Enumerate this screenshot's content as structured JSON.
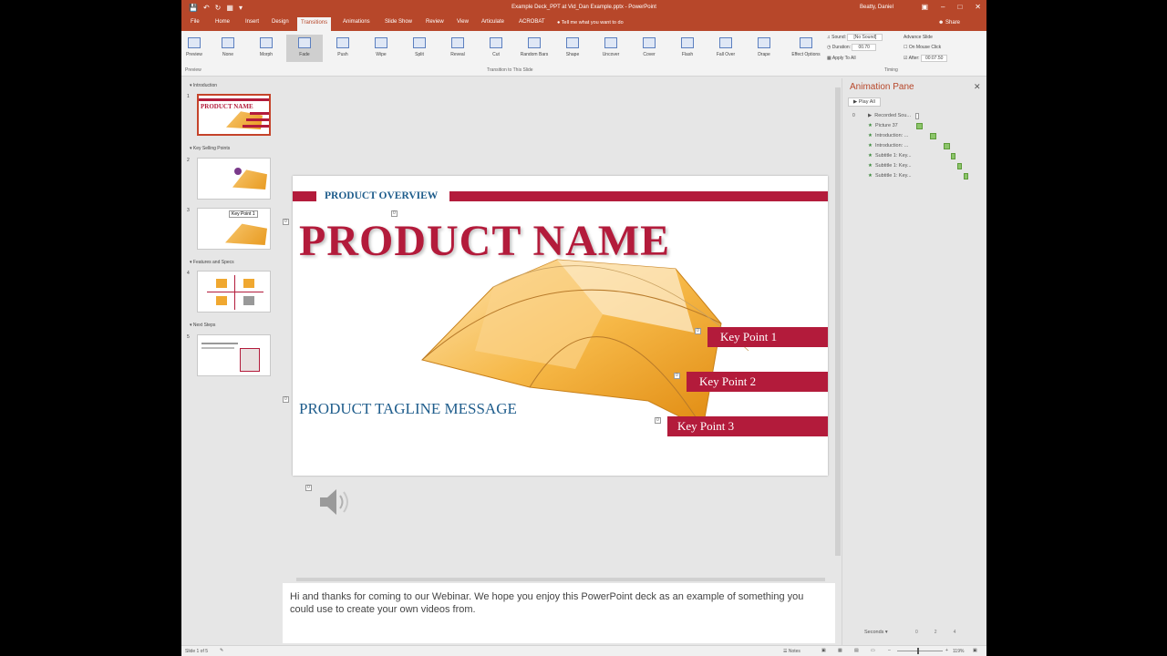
{
  "window": {
    "title": "Example Deck_PPT at Vid_Dan Example.pptx - PowerPoint",
    "user": "Beatty, Daniel"
  },
  "ribbon": {
    "tabs": [
      "File",
      "Home",
      "Insert",
      "Design",
      "Transitions",
      "Animations",
      "Slide Show",
      "Review",
      "View",
      "Articulate",
      "ACROBAT"
    ],
    "active_tab": "Transitions",
    "tell_me": "Tell me what you want to do",
    "share": "Share",
    "preview_label": "Preview",
    "preview_group": "Preview",
    "transitions": [
      "None",
      "Morph",
      "Fade",
      "Push",
      "Wipe",
      "Split",
      "Reveal",
      "Cut",
      "Random Bars",
      "Shape",
      "Uncover",
      "Cover",
      "Flash",
      "Fall Over",
      "Drape"
    ],
    "selected_transition": "Fade",
    "effect_options": "Effect Options",
    "group_label": "Transition to This Slide",
    "timing": {
      "sound_label": "Sound:",
      "sound_value": "[No Sound]",
      "duration_label": "Duration:",
      "duration_value": "00.70",
      "apply_all": "Apply To All",
      "advance_label": "Advance Slide",
      "on_click": "On Mouse Click",
      "after_label": "After:",
      "after_value": "00:07.50",
      "group_label": "Timing"
    }
  },
  "slides_panel": {
    "sections": [
      {
        "name": "Introduction"
      },
      {
        "name": "Key Selling Points"
      },
      {
        "name": "Features and Specs"
      },
      {
        "name": "Next Steps"
      }
    ],
    "slide_numbers": [
      "1",
      "2",
      "3",
      "4",
      "5"
    ],
    "thumb1_title": "PRODUCT NAME",
    "thumb3_tooltip": "Key Point 1"
  },
  "slide": {
    "overview": "PRODUCT OVERVIEW",
    "product_name": "PRODUCT NAME",
    "tagline": "PRODUCT TAGLINE MESSAGE",
    "key_points": [
      "Key Point 1",
      "Key Point 2",
      "Key Point 3"
    ],
    "anim_tag": "0"
  },
  "notes": {
    "text": "Hi and thanks for coming to our Webinar. We hope you enjoy this PowerPoint deck as an example of something you could use to create your own videos from."
  },
  "animation_pane": {
    "title": "Animation Pane",
    "play_all": "Play All",
    "items": [
      {
        "label": "Recorded Sou..."
      },
      {
        "label": "Picture 37"
      },
      {
        "label": "Introduction: ..."
      },
      {
        "label": "Introduction: ..."
      },
      {
        "label": "Subtitle 1: Key..."
      },
      {
        "label": "Subtitle 1: Key..."
      },
      {
        "label": "Subtitle 1: Key..."
      }
    ],
    "first_index": "0",
    "seconds": "Seconds",
    "ticks": [
      "0",
      "2",
      "4"
    ]
  },
  "status": {
    "slide_info": "Slide 1 of 5",
    "notes": "Notes",
    "zoom": "119%"
  },
  "colors": {
    "accent": "#b7472a",
    "brand_red": "#b31b3b",
    "brand_blue": "#1f5d8c"
  }
}
